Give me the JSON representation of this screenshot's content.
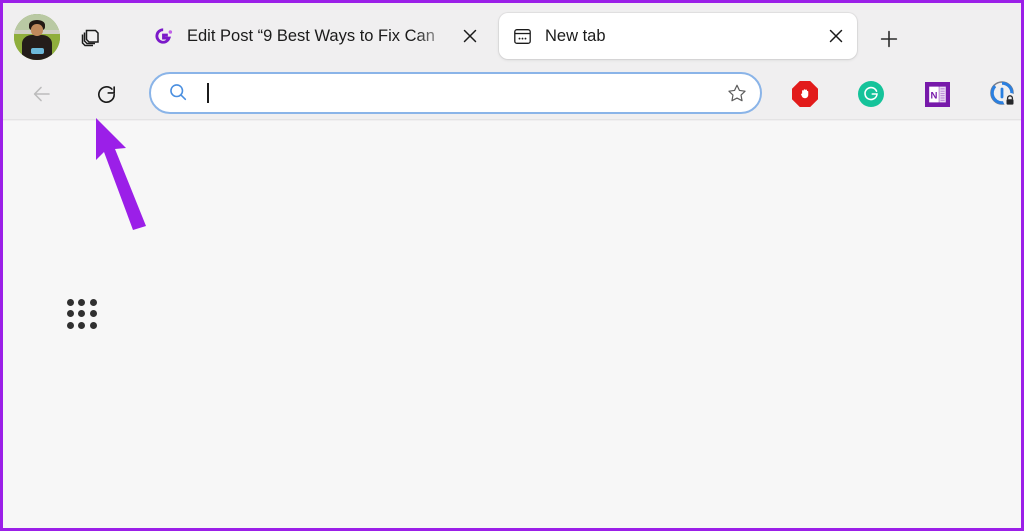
{
  "window": {
    "annotation_border_color": "#9b1fe8",
    "toolbar_background": "#f0eff0",
    "content_background": "#f7f7f7"
  },
  "tab_strip": {
    "profile_avatar": {
      "icon": "user-avatar-photo",
      "label": "Profile"
    },
    "collections_button": {
      "icon": "collections-icon",
      "label": "Collections"
    },
    "tabs": [
      {
        "title": "Edit Post “9 Best Ways to Fix Can",
        "favicon": "gt-logo-favicon",
        "active": false,
        "close_label": "×"
      },
      {
        "title": "New tab",
        "favicon": "new-tab-window-icon",
        "active": true,
        "close_label": "×"
      }
    ],
    "new_tab_button": {
      "icon": "plus-icon",
      "label": "New tab"
    }
  },
  "toolbar": {
    "back_button": {
      "icon": "arrow-left-icon",
      "label": "Back",
      "enabled": false
    },
    "reload_button": {
      "icon": "reload-icon",
      "label": "Refresh",
      "enabled": true
    },
    "address_bar": {
      "value": "",
      "placeholder": "",
      "search_icon": "search-icon",
      "favorite_icon": "star-outline-icon",
      "focused": true,
      "border_color": "#8ab4e8"
    },
    "extensions": [
      {
        "name": "AdBlock",
        "icon": "adblock-stop-hand-icon",
        "color": "#e21b1b"
      },
      {
        "name": "Grammarly",
        "icon": "grammarly-g-icon",
        "color": "#15c39a"
      },
      {
        "name": "OneNote",
        "icon": "onenote-n-icon",
        "color": "#7719aa"
      },
      {
        "name": "Password Manager",
        "icon": "lock-badge-icon",
        "color": "#2a7fe0"
      }
    ]
  },
  "page": {
    "apps_grid_button": {
      "icon": "apps-grid-icon",
      "label": "Apps"
    },
    "annotation": {
      "shape": "arrow",
      "color": "#9b1fe8",
      "points_to": "reload-button"
    }
  }
}
